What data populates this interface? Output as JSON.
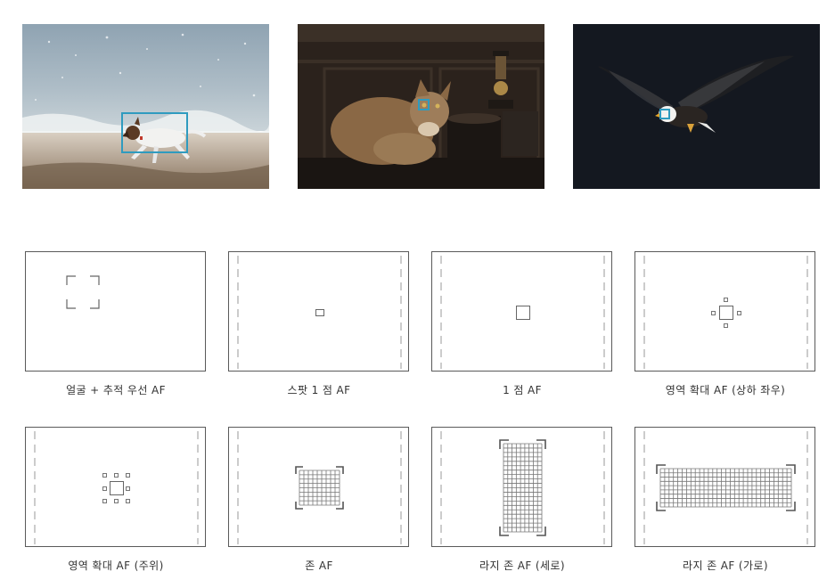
{
  "photos": [
    {
      "subject": "dog on beach",
      "frame": "wide"
    },
    {
      "subject": "cat",
      "frame": "eye"
    },
    {
      "subject": "bird in flight",
      "frame": "eye"
    }
  ],
  "colors": {
    "af_frame": "#2f9bbf",
    "panel_border": "#5a5a5a",
    "mark": "#666666",
    "dash": "#aaaaaa",
    "caption": "#333333"
  },
  "modes": [
    {
      "label": "얼굴 + 추적 우선 AF",
      "kind": "face"
    },
    {
      "label": "스팟 1 점 AF",
      "kind": "spot"
    },
    {
      "label": "1 점 AF",
      "kind": "single"
    },
    {
      "label": "영역 확대 AF (상하 좌우)",
      "kind": "expand4"
    },
    {
      "label": "영역 확대 AF (주위)",
      "kind": "expand8"
    },
    {
      "label": "존 AF",
      "kind": "zone"
    },
    {
      "label": "라지 존 AF (세로)",
      "kind": "large-v"
    },
    {
      "label": "라지 존 AF (가로)",
      "kind": "large-h"
    }
  ]
}
